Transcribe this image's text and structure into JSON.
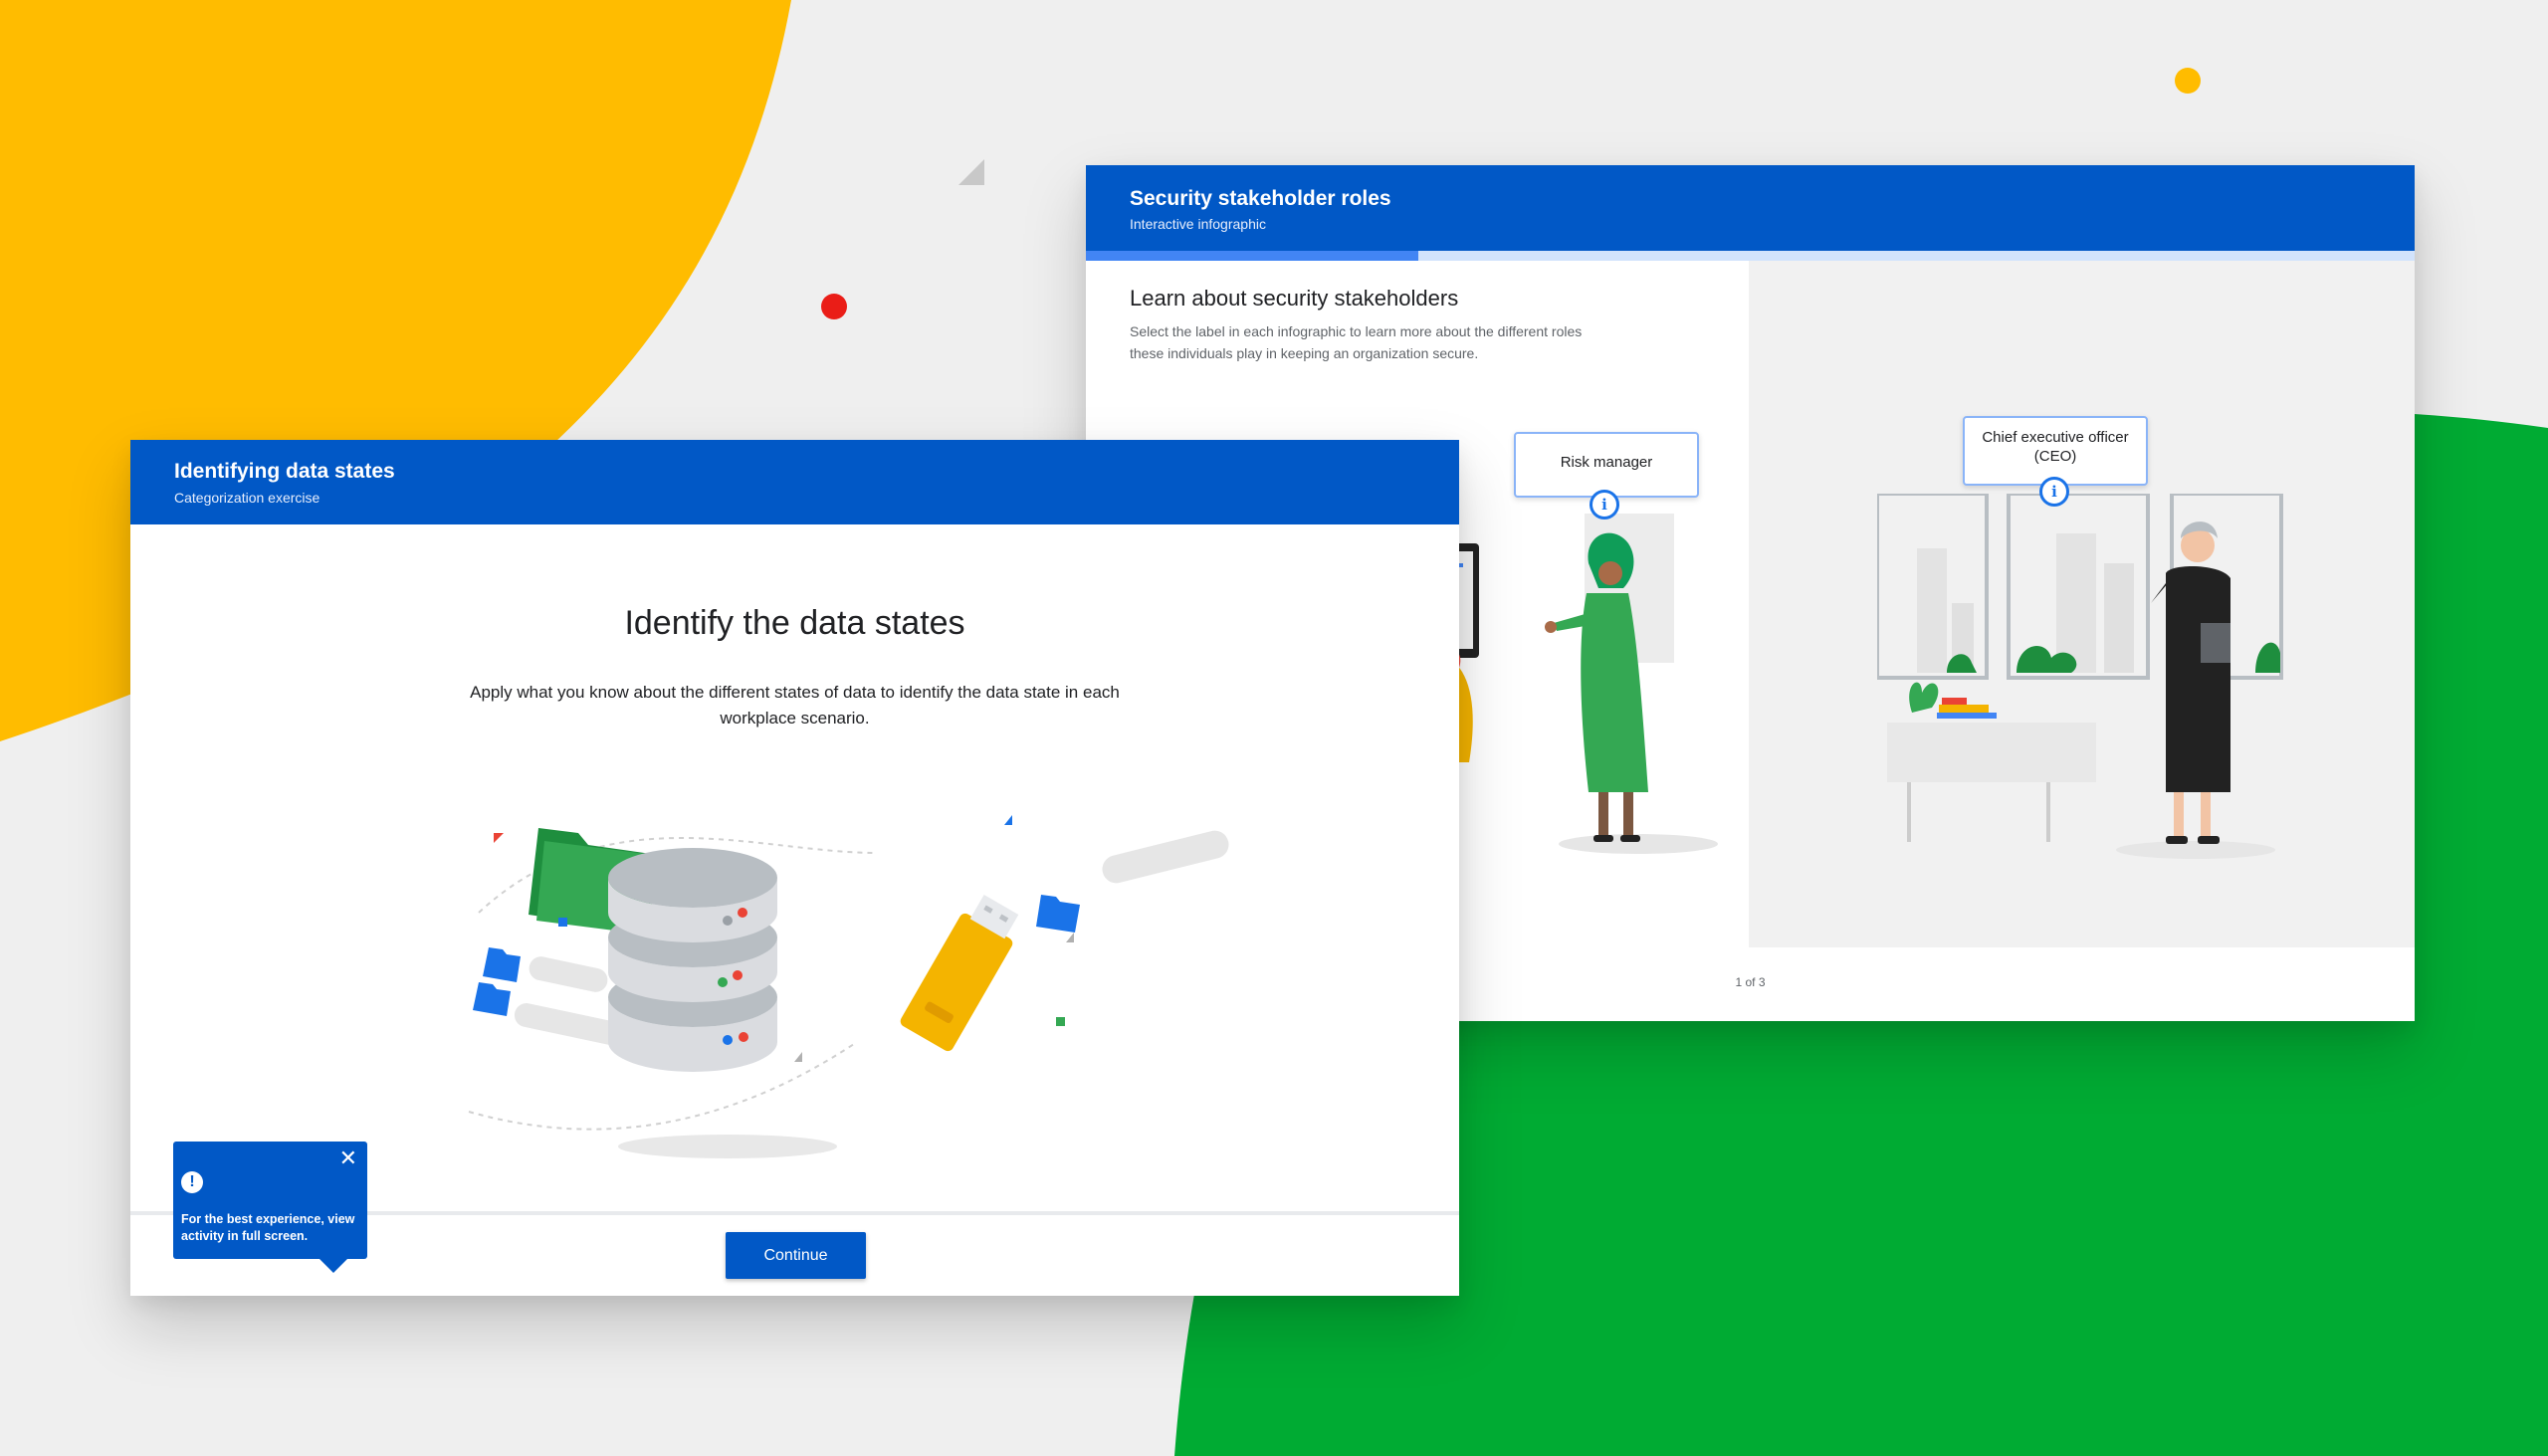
{
  "colors": {
    "header_blue": "#0158c6",
    "accent_yellow": "#ffbc00",
    "accent_green": "#00ab33",
    "accent_red": "#ea1d17"
  },
  "back_card": {
    "title": "Security stakeholder roles",
    "subtitle": "Interactive infographic",
    "progress_fraction": 0.25,
    "heading": "Learn about security stakeholders",
    "description": "Select the label in each infographic to learn more about the different roles these individuals play in keeping an organization secure.",
    "callouts": [
      {
        "label": "Risk manager",
        "icon": "info-icon"
      },
      {
        "label": "Chief executive officer (CEO)",
        "icon": "info-icon"
      }
    ],
    "pager": "1 of 3"
  },
  "front_card": {
    "title": "Identifying data states",
    "subtitle": "Categorization exercise",
    "heading": "Identify the data states",
    "description": "Apply what you know about the different states of data to identify the data state in each workplace scenario.",
    "continue_label": "Continue",
    "toast": {
      "icon": "alert-icon",
      "close_icon": "close-icon",
      "message": "For the best experience, view activity in full screen."
    }
  }
}
